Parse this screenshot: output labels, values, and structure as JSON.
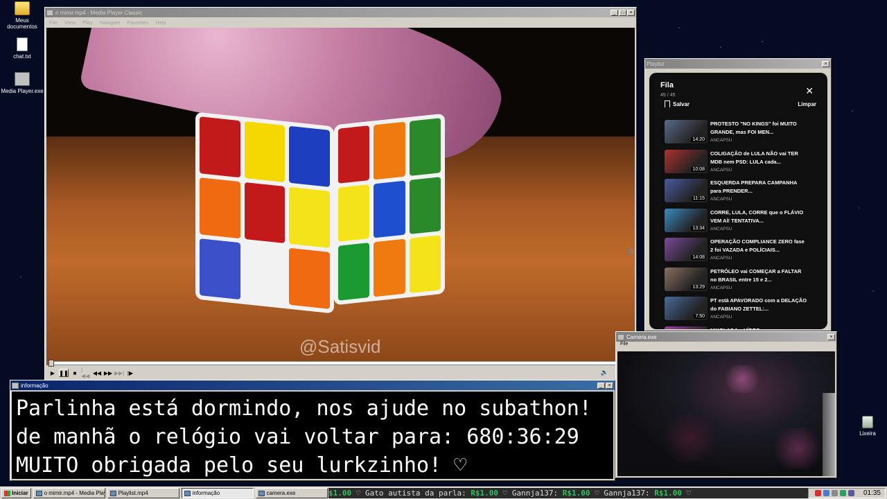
{
  "desktop": {
    "icons": [
      {
        "label": "Meus documentos",
        "icon": "folder-icon"
      },
      {
        "label": "chat.txt",
        "icon": "text-file-icon"
      },
      {
        "label": "Media Player.exe",
        "icon": "media-player-icon"
      }
    ],
    "recycle_bin_label": "Lixeira"
  },
  "media_player": {
    "title": "o mimir.mp4 - Media Player Classic",
    "menu": [
      "File",
      "View",
      "Play",
      "Navigate",
      "Favorites",
      "Help"
    ],
    "watermark": "@Satisvid",
    "progress": 0.0
  },
  "playlist_window": {
    "title": "Playlist",
    "queue_title": "Fila",
    "queue_count": "45 / 45",
    "save_label": "Salvar",
    "clear_label": "Limpar",
    "items": [
      {
        "title": "PROTESTO \"NO KINGS\" foi MUITO GRANDE, mas FOI MEN...",
        "channel": "ANCAPSU",
        "duration": "14:20",
        "color": "#5a6a8a"
      },
      {
        "title": "COLIGAÇÃO de LULA NÃO vai TER MDB nem PSD: LULA cada...",
        "channel": "ANCAPSU",
        "duration": "10:08",
        "color": "#b03030"
      },
      {
        "title": "ESQUERDA PREPARA CAMPANHA para PRENDER...",
        "channel": "ANCAPSU",
        "duration": "11:15",
        "color": "#4a5aa0"
      },
      {
        "title": "CORRE, LULA, CORRE que o FLÁVIO VEM AÍ! TENTATIVA...",
        "channel": "ANCAPSU",
        "duration": "13:34",
        "color": "#3a8ac0"
      },
      {
        "title": "OPERAÇÃO COMPLIANCE ZERO fase 2 foi VAZADA e POLÍCIAIS...",
        "channel": "ANCAPSU",
        "duration": "14:08",
        "color": "#7a4a9a"
      },
      {
        "title": "PETRÓLEO vai COMEÇAR a FALTAR no BRASIL entre 15 e 2...",
        "channel": "ANCAPSU",
        "duration": "13:29",
        "color": "#8a7060"
      },
      {
        "title": "PT está APAVORADO com a DELAÇÃO do FABIANO ZETTEL:...",
        "channel": "ANCAPSU",
        "duration": "7:50",
        "color": "#4a6a9a"
      },
      {
        "title": "NIKOLAS faz VÍDEO",
        "channel": "",
        "duration": "",
        "color": "#a040a0"
      }
    ]
  },
  "info_window": {
    "title": "informação",
    "lines": [
      "Parlinha está dormindo, nos ajude no subathon!",
      "de manhã o relógio vai voltar para:  680:36:29",
      "MUITO obrigada pelo seu lurkzinho! ♡"
    ]
  },
  "camera_window": {
    "title": "Camera.exe",
    "menu": "File"
  },
  "taskbar": {
    "start_label": "Iniciar",
    "tasks": [
      {
        "label": "o mimir.mp4 - Media Playe...",
        "pressed": false
      },
      {
        "label": "Playlist.mp4",
        "pressed": false
      },
      {
        "label": "informação",
        "pressed": true
      },
      {
        "label": "camera.exe",
        "pressed": false
      }
    ],
    "ticker": [
      {
        "money": "$1.00",
        "text": " ♡  Gato autista da parla: "
      },
      {
        "money": "R$1.00",
        "text": " ♡   Gannja137: "
      },
      {
        "money": "R$1.00",
        "text": " ♡   Gannja137: "
      },
      {
        "money": "R$1.00",
        "text": " ♡"
      }
    ],
    "clock": "01:35"
  }
}
